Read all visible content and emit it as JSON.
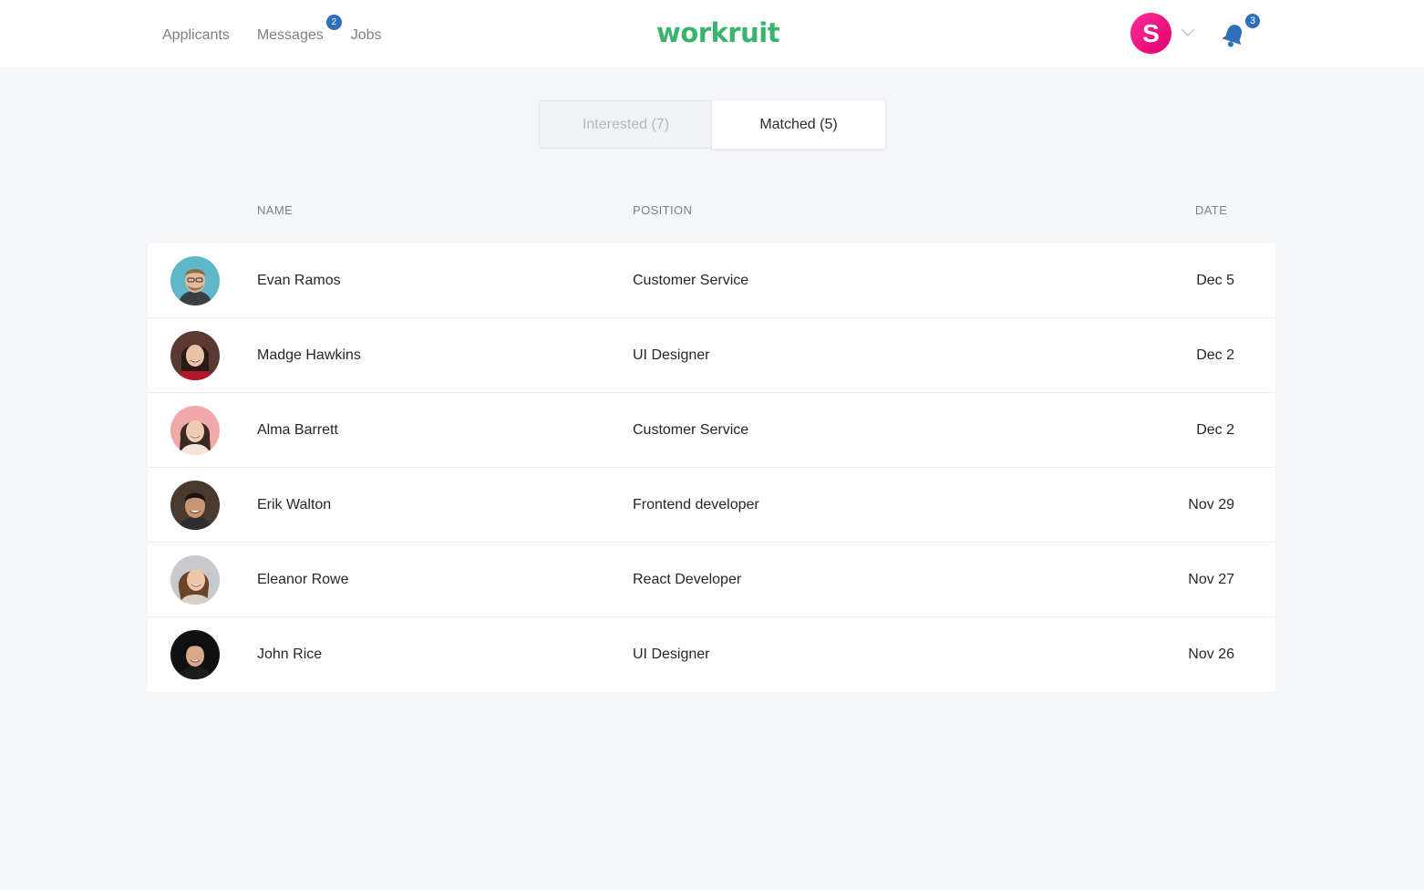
{
  "nav": {
    "items": [
      {
        "label": "Applicants"
      },
      {
        "label": "Messages",
        "badge": "2"
      },
      {
        "label": "Jobs"
      }
    ]
  },
  "logo": "workruit",
  "user": {
    "initial": "S"
  },
  "notifications": {
    "count": "3"
  },
  "tabs": [
    {
      "label": "Interested (7)",
      "active": false
    },
    {
      "label": "Matched (5)",
      "active": true
    }
  ],
  "table": {
    "headers": {
      "name": "NAME",
      "position": "POSITION",
      "date": "DATE"
    },
    "rows": [
      {
        "name": "Evan Ramos",
        "position": "Customer Service",
        "date": "Dec 5"
      },
      {
        "name": "Madge Hawkins",
        "position": "UI Designer",
        "date": "Dec 2"
      },
      {
        "name": "Alma Barrett",
        "position": "Customer Service",
        "date": "Dec 2"
      },
      {
        "name": "Erik Walton",
        "position": "Frontend developer",
        "date": "Nov 29"
      },
      {
        "name": "Eleanor Rowe",
        "position": "React Developer",
        "date": "Nov 27"
      },
      {
        "name": "John Rice",
        "position": "UI Designer",
        "date": "Nov 26"
      }
    ]
  },
  "colors": {
    "brand": "#3bb36c",
    "badge": "#2f6eb8",
    "avatar_gradient_start": "#ff2d9b",
    "avatar_gradient_end": "#e0006c",
    "background": "#f5f6fa"
  }
}
